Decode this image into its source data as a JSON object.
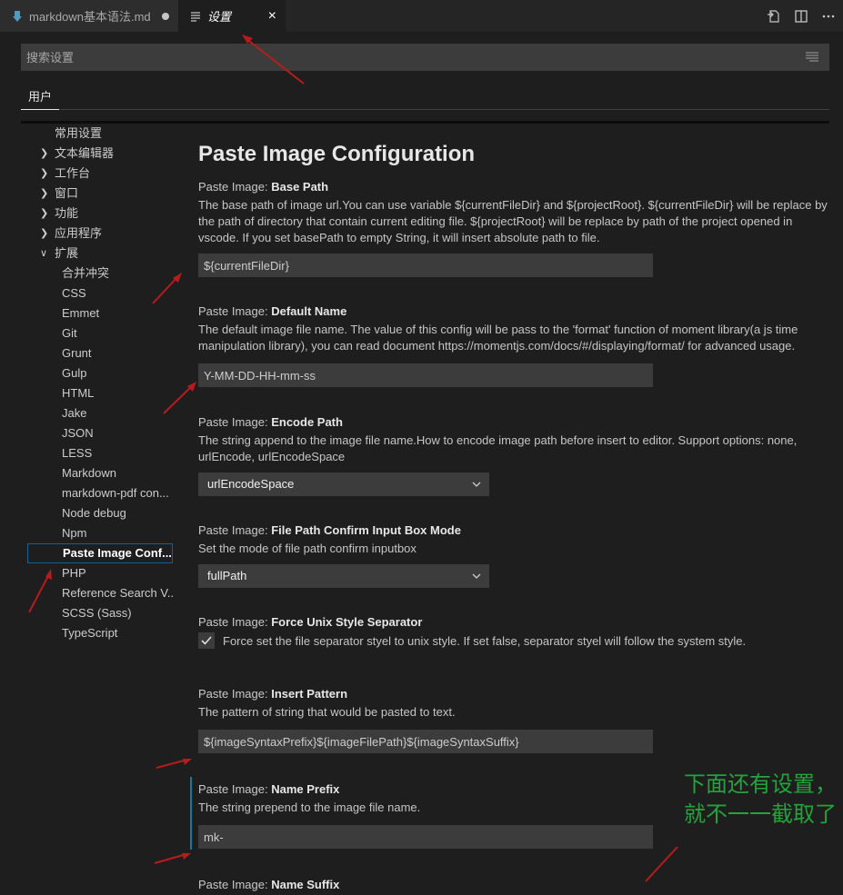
{
  "tabs": [
    {
      "label": "markdown基本语法.md",
      "icon": "markdown-icon",
      "modified": true
    },
    {
      "label": "设置",
      "icon": "settings-file-icon",
      "active": true
    }
  ],
  "tab_actions": [
    "open-settings-json-icon",
    "split-editor-icon",
    "more-actions-icon"
  ],
  "search": {
    "placeholder": "搜索设置"
  },
  "scope_tab": "用户",
  "tree": [
    {
      "label": "常用设置",
      "level": 0
    },
    {
      "label": "文本编辑器",
      "level": 0,
      "chevron": "right"
    },
    {
      "label": "工作台",
      "level": 0,
      "chevron": "right"
    },
    {
      "label": "窗口",
      "level": 0,
      "chevron": "right"
    },
    {
      "label": "功能",
      "level": 0,
      "chevron": "right"
    },
    {
      "label": "应用程序",
      "level": 0,
      "chevron": "right"
    },
    {
      "label": "扩展",
      "level": 0,
      "chevron": "down"
    },
    {
      "label": "合并冲突",
      "level": 1
    },
    {
      "label": "CSS",
      "level": 1
    },
    {
      "label": "Emmet",
      "level": 1
    },
    {
      "label": "Git",
      "level": 1
    },
    {
      "label": "Grunt",
      "level": 1
    },
    {
      "label": "Gulp",
      "level": 1
    },
    {
      "label": "HTML",
      "level": 1
    },
    {
      "label": "Jake",
      "level": 1
    },
    {
      "label": "JSON",
      "level": 1
    },
    {
      "label": "LESS",
      "level": 1
    },
    {
      "label": "Markdown",
      "level": 1
    },
    {
      "label": "markdown-pdf con...",
      "level": 1
    },
    {
      "label": "Node debug",
      "level": 1
    },
    {
      "label": "Npm",
      "level": 1
    },
    {
      "label": "Paste Image Conf...",
      "level": 1,
      "selected": true
    },
    {
      "label": "PHP",
      "level": 1
    },
    {
      "label": "Reference Search V...",
      "level": 1
    },
    {
      "label": "SCSS (Sass)",
      "level": 1
    },
    {
      "label": "TypeScript",
      "level": 1
    }
  ],
  "section_title": "Paste Image Configuration",
  "settings": [
    {
      "category": "Paste Image: ",
      "name": "Base Path",
      "desc": "The base path of image url.You can use variable ${currentFileDir} and ${projectRoot}. ${currentFileDir} will be replace by the path of directory that contain current editing file. ${projectRoot} will be replace by path of the project opened in vscode. If you set basePath to empty String, it will insert absolute path to file.",
      "value": "${currentFileDir}"
    },
    {
      "category": "Paste Image: ",
      "name": "Default Name",
      "desc": "The default image file name. The value of this config will be pass to the 'format' function of moment library(a js time manipulation library), you can read document https://momentjs.com/docs/#/displaying/format/ for advanced usage.",
      "value": "Y-MM-DD-HH-mm-ss"
    },
    {
      "category": "Paste Image: ",
      "name": "Encode Path",
      "desc": "The string append to the image file name.How to encode image path before insert to editor. Support options: none, urlEncode, urlEncodeSpace",
      "value": "urlEncodeSpace"
    },
    {
      "category": "Paste Image: ",
      "name": "File Path Confirm Input Box Mode",
      "desc": "Set the mode of file path confirm inputbox",
      "value": "fullPath"
    },
    {
      "category": "Paste Image: ",
      "name": "Force Unix Style Separator",
      "desc": "Force set the file separator styel to unix style. If set false, separator styel will follow the system style.",
      "checked": true
    },
    {
      "category": "Paste Image: ",
      "name": "Insert Pattern",
      "desc": "The pattern of string that would be pasted to text.",
      "value": "${imageSyntaxPrefix}${imageFilePath}${imageSyntaxSuffix}"
    },
    {
      "category": "Paste Image: ",
      "name": "Name Prefix",
      "desc": "The string prepend to the image file name.",
      "value": "mk-"
    },
    {
      "category": "Paste Image: ",
      "name": "Name Suffix"
    }
  ],
  "annotation_note": "下面还有设置，就不一一截取了",
  "colors": {
    "accent": "#0e639c",
    "annotation": "#b71c1c",
    "note": "#22a33b",
    "background": "#1e1e1e"
  }
}
